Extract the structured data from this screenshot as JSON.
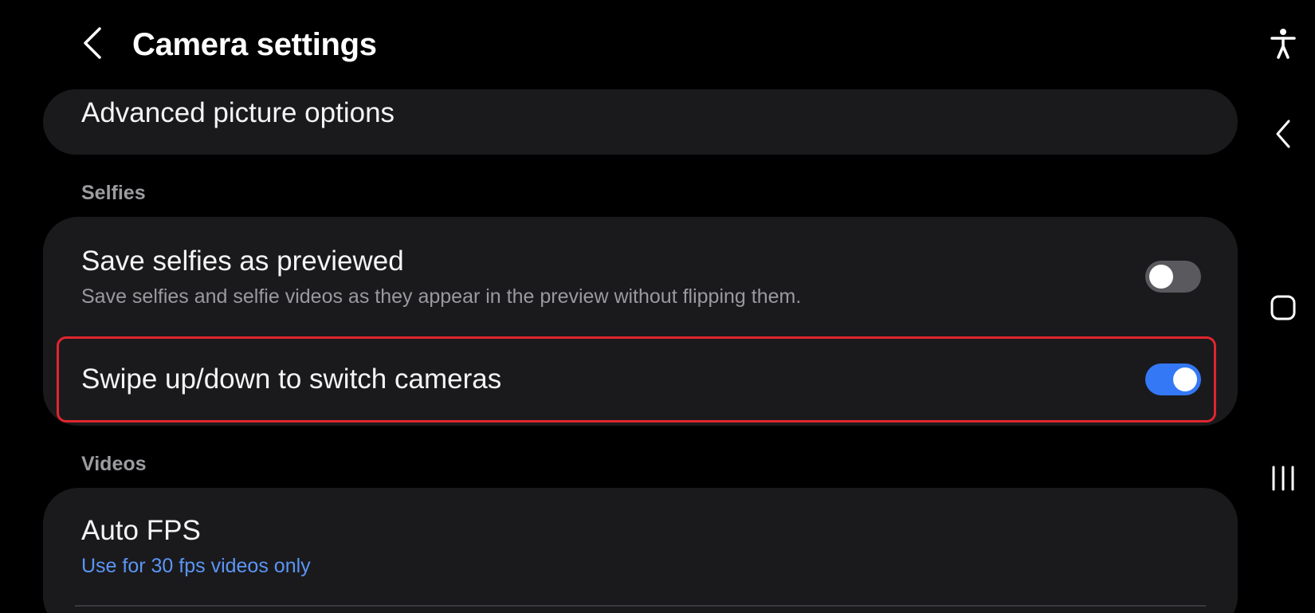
{
  "header": {
    "title": "Camera settings",
    "back_icon": "chevron-left-icon"
  },
  "advanced": {
    "label": "Advanced picture options"
  },
  "selfies": {
    "section_label": "Selfies",
    "save_as_previewed": {
      "title": "Save selfies as previewed",
      "subtitle": "Save selfies and selfie videos as they appear in the preview without flipping them.",
      "enabled": false
    },
    "swipe_switch": {
      "title": "Swipe up/down to switch cameras",
      "enabled": true
    }
  },
  "videos": {
    "section_label": "Videos",
    "auto_fps": {
      "title": "Auto FPS",
      "subtitle": "Use for 30 fps videos only"
    }
  },
  "navbar": {
    "icons": [
      "accessibility-icon",
      "back-icon",
      "home-icon",
      "recents-icon"
    ]
  },
  "colors": {
    "background": "#000000",
    "card": "#1a1a1d",
    "toggle_on": "#3478f6",
    "toggle_off": "#5a5a5e",
    "accent_text": "#5b95f5",
    "highlight": "#e0252e"
  }
}
